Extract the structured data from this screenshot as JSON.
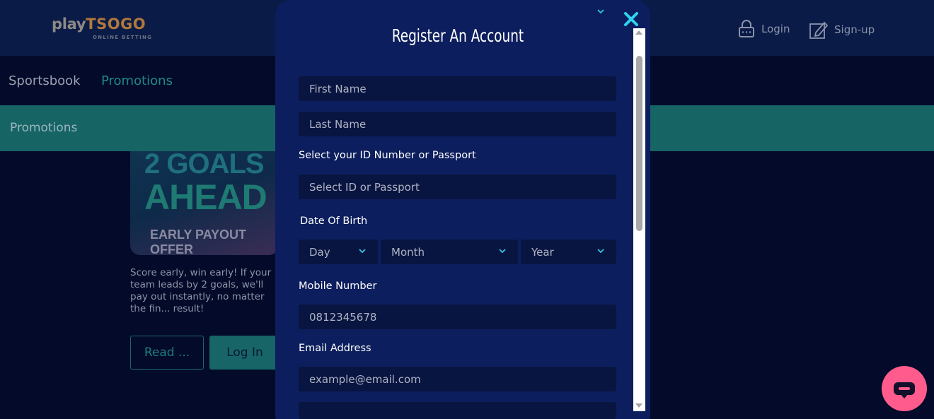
{
  "header": {
    "logo_play": "play",
    "logo_tsogo": "TSOGO",
    "logo_sub": "ONLINE BETTING",
    "login_label": "Login",
    "signup_label": "Sign-up"
  },
  "nav": {
    "items": [
      {
        "label": "Sportsbook"
      },
      {
        "label": "Promotions"
      }
    ]
  },
  "banner": {
    "title": "Promotions"
  },
  "promo": {
    "image_line1": "2 GOALS",
    "image_line2": "AHEAD",
    "image_offer": "EARLY PAYOUT OFFER",
    "description": "Score early, win early! If your team leads by 2 goals, we'll pay out instantly, no matter the fin... result!",
    "read_label": "Read ...",
    "login_label": "Log In"
  },
  "modal": {
    "title": "Register An Account",
    "first_name_placeholder": "First Name",
    "last_name_placeholder": "Last Name",
    "id_label": "Select your ID Number or Passport",
    "id_select": "Select ID or Passport",
    "dob_label": "Date Of Birth",
    "dob_day": "Day",
    "dob_month": "Month",
    "dob_year": "Year",
    "mobile_label": "Mobile Number",
    "mobile_placeholder": "0812345678",
    "email_label": "Email Address",
    "email_placeholder": "example@email.com"
  },
  "colors": {
    "page_bg": "#030a2a",
    "header_bg": "#0a1b47",
    "modal_bg": "#0c1e5d",
    "field_bg": "#091541",
    "accent_teal": "#176465",
    "close_icon": "#2fd3f0",
    "chat_button": "#ff5c8d"
  }
}
